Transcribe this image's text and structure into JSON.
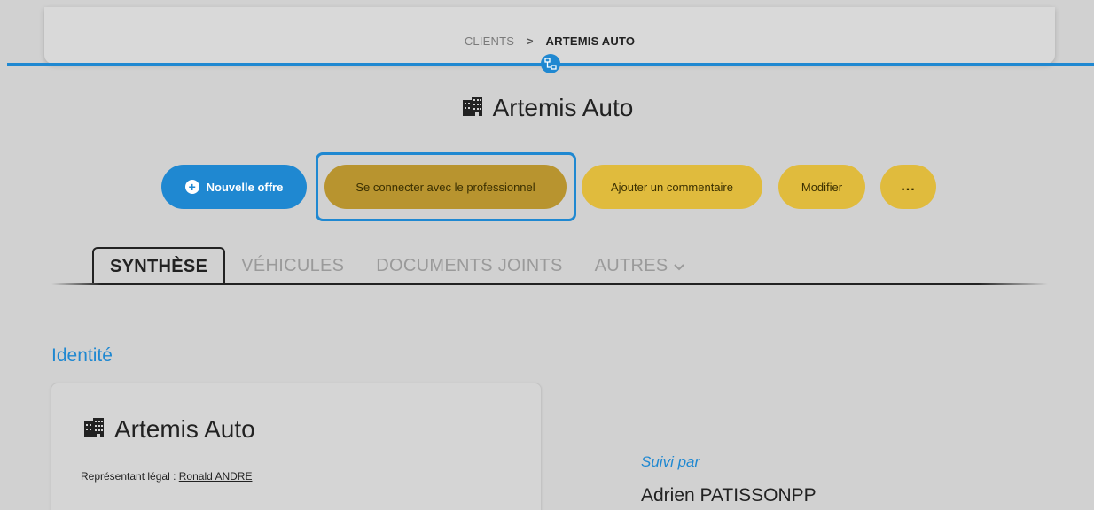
{
  "breadcrumb": {
    "parent": "CLIENTS",
    "separator": ">",
    "current": "ARTEMIS AUTO"
  },
  "page": {
    "title": "Artemis Auto"
  },
  "actions": {
    "new_offer": "Nouvelle offre",
    "connect": "Se connecter avec le professionnel",
    "add_comment": "Ajouter un commentaire",
    "edit": "Modifier",
    "more": "..."
  },
  "tabs": [
    {
      "label": "SYNTHÈSE",
      "active": true
    },
    {
      "label": "VÉHICULES",
      "active": false
    },
    {
      "label": "DOCUMENTS JOINTS",
      "active": false
    },
    {
      "label": "AUTRES",
      "active": false
    }
  ],
  "identity": {
    "section_title": "Identité",
    "card_title": "Artemis Auto",
    "rep_label": "Représentant légal :",
    "rep_name": "Ronald ANDRE"
  },
  "follow": {
    "label": "Suivi par",
    "name": "Adrien PATISSONPP"
  },
  "colors": {
    "accent": "#1f88d1",
    "button_yellow": "#e0bb3d",
    "button_active": "#b8942f",
    "background": "#d1d1d1"
  },
  "icons": {
    "network": "network-icon",
    "building": "building-icon",
    "plus": "plus-circle-icon",
    "chevron": "chevron-down-icon"
  }
}
